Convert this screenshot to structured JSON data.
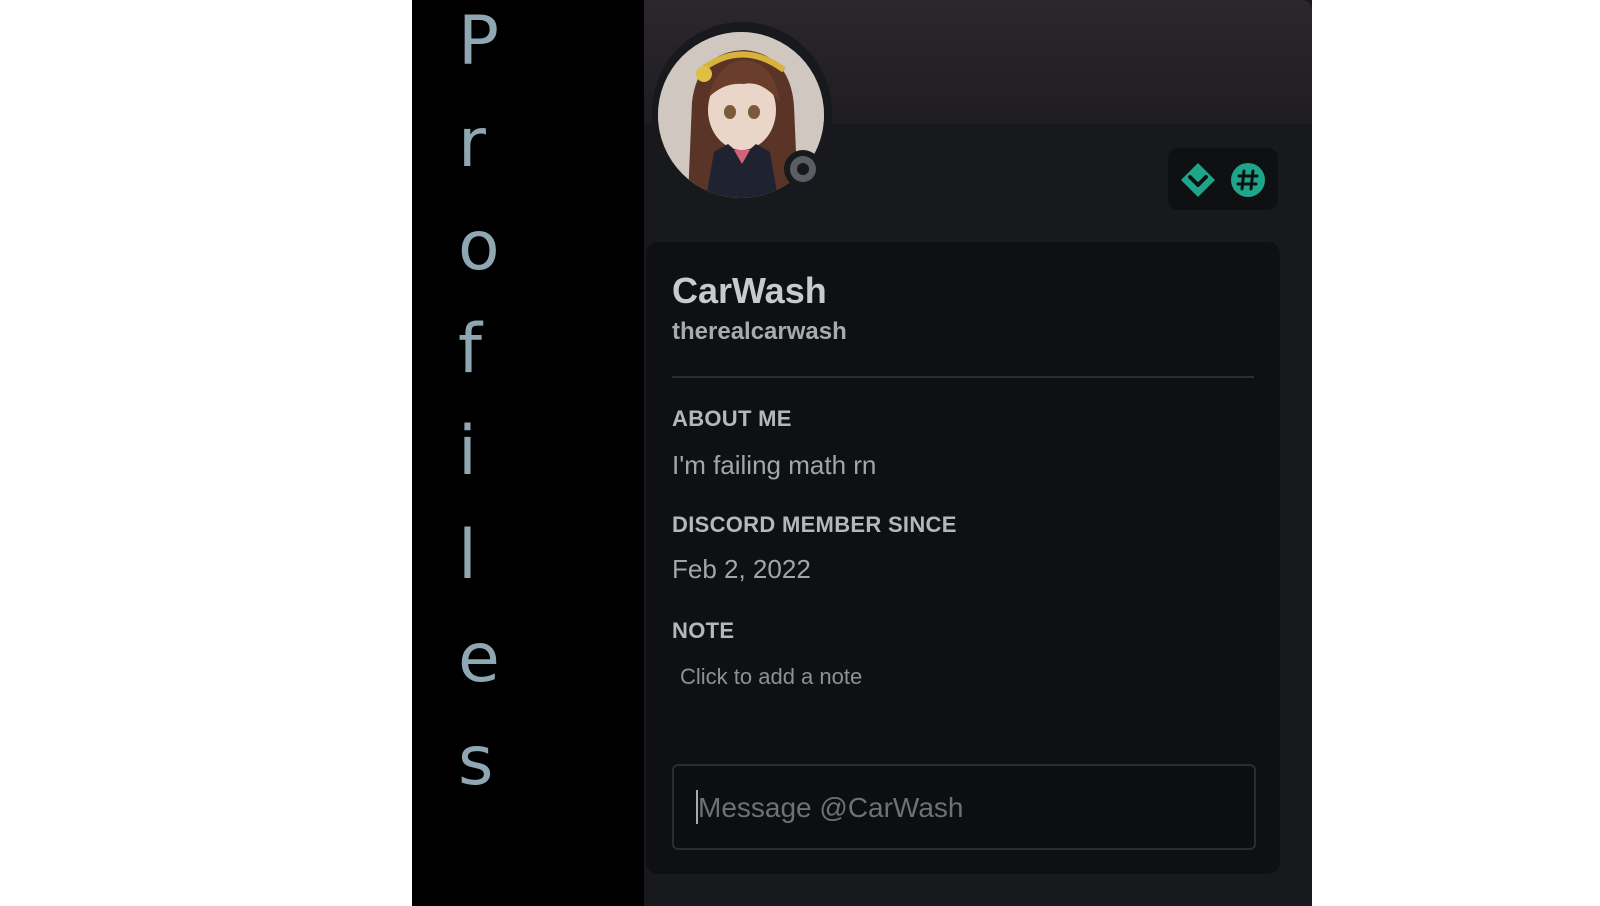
{
  "side_title": {
    "letters": [
      "P",
      "r",
      "o",
      "f",
      "i",
      "l",
      "e",
      "s"
    ]
  },
  "profile": {
    "display_name": "CarWash",
    "username": "therealcarwash",
    "about_heading": "ABOUT ME",
    "about_text": "I'm failing math rn",
    "member_since_heading": "DISCORD MEMBER SINCE",
    "member_since_date": "Feb 2, 2022",
    "note_heading": "NOTE",
    "note_placeholder": "Click to add a note",
    "message_placeholder": "Message @CarWash",
    "status": "offline",
    "badges": [
      "hypesquad-balance-icon",
      "active-developer-icon"
    ],
    "colors": {
      "badge_accent": "#1fa68a",
      "card_background": "#18191c",
      "inner_background": "#0f1012",
      "side_text": "#8fa7b3"
    }
  }
}
